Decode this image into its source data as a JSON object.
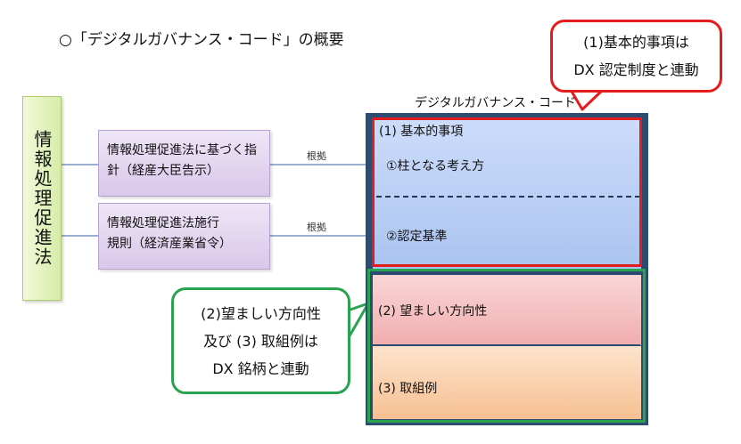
{
  "title": "○「デジタルガバナンス・コード」の概要",
  "law": {
    "label": "情報処理促進法"
  },
  "documents": [
    {
      "line1": "情報処理促進法に基づく指",
      "line2": "針（経産大臣告示）",
      "basis": "根拠"
    },
    {
      "line1": "情報処理促進法施行",
      "line2": "規則（経済産業省令）",
      "basis": "根拠"
    }
  ],
  "code": {
    "title": "デジタルガバナンス・コード",
    "basic": "(1) 基本的事項",
    "pillar": "①柱となる考え方",
    "criteria": "②認定基準",
    "direction": "(2) 望ましい方向性",
    "examples": "(3) 取組例"
  },
  "callouts": {
    "red": {
      "line1": "(1)基本的事項は",
      "line2": "DX 認定制度と連動"
    },
    "green": {
      "line1": "(2)望ましい方向性",
      "line2": "及び (3) 取組例は",
      "line3": "DX 銘柄と連動"
    }
  },
  "colors": {
    "red_frame": "#e31d1d",
    "green_frame": "#29a350",
    "navy": "#2d4d70"
  }
}
